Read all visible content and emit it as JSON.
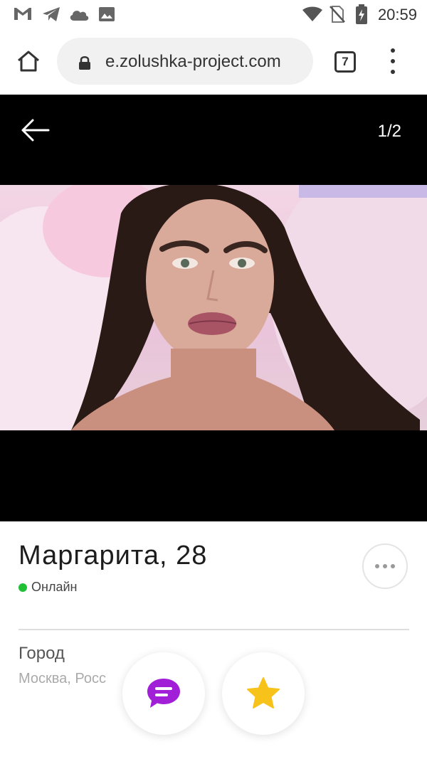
{
  "status_bar": {
    "time": "20:59",
    "left_icons": [
      "gmail-icon",
      "telegram-icon",
      "cloud-icon",
      "image-icon"
    ],
    "right_icons": [
      "wifi-icon",
      "no-sim-icon",
      "battery-icon"
    ]
  },
  "browser": {
    "url": "e.zolushka-project.com",
    "tab_count": "7"
  },
  "viewer": {
    "counter": "1/2"
  },
  "profile": {
    "name_age": "Маргарита, 28",
    "status": "Онлайн",
    "status_color": "#1fbf36",
    "city_label": "Город",
    "city_value": "Москва, Росс"
  },
  "actions": {
    "chat_icon_color": "#a21fd8",
    "favorite_icon_color": "#f7c21a"
  }
}
